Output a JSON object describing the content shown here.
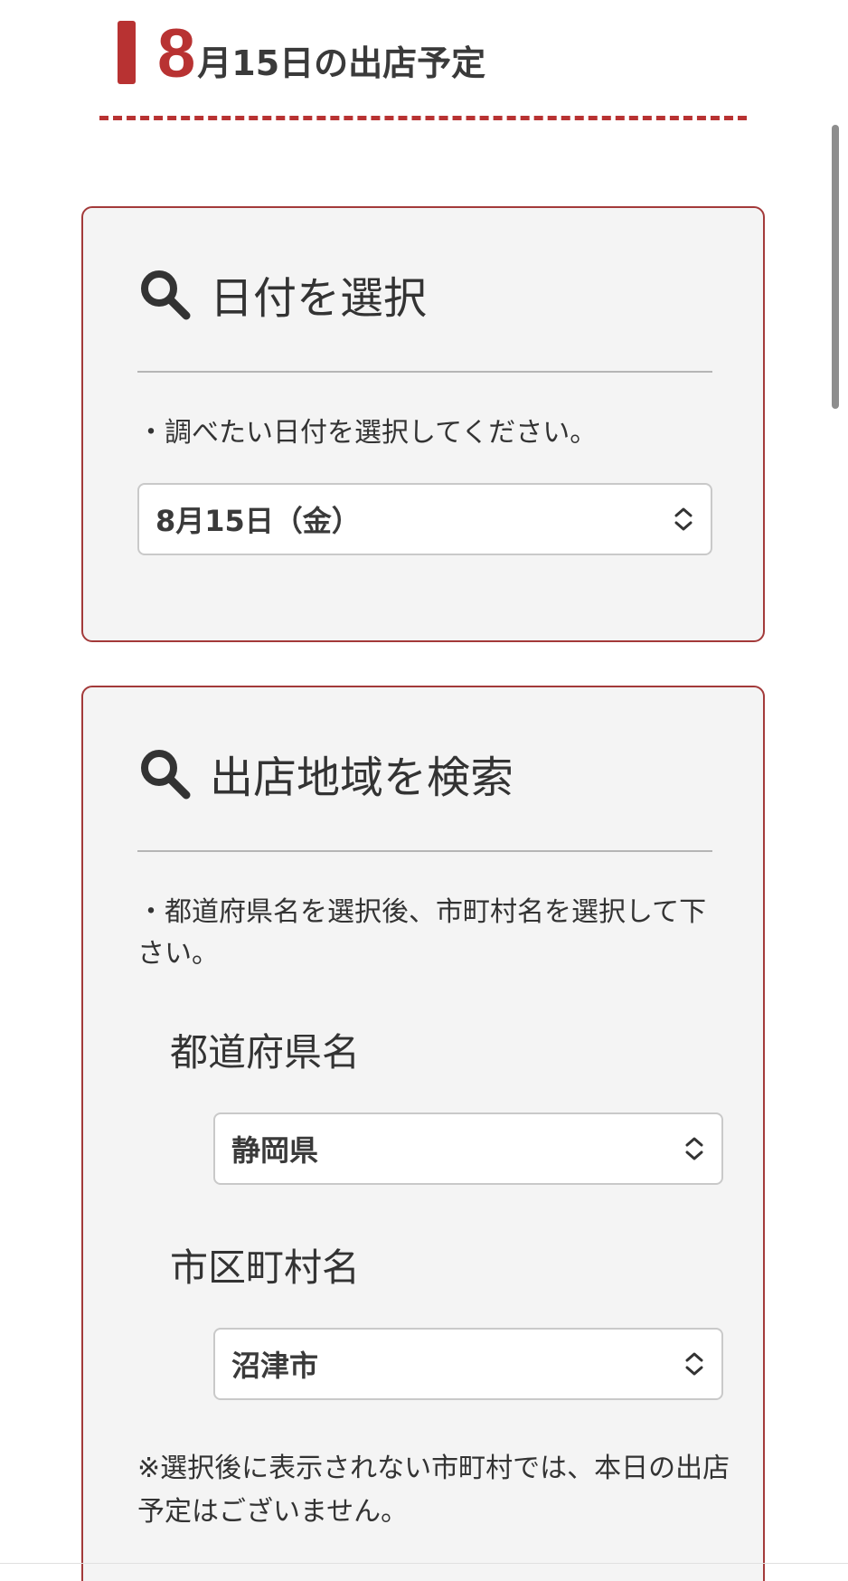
{
  "header": {
    "big_number": "8",
    "title_rest": "月15日の出店予定"
  },
  "date_panel": {
    "title": "日付を選択",
    "instruction": "・調べたい日付を選択してください。",
    "select_value": "8月15日（金）"
  },
  "area_panel": {
    "title": "出店地域を検索",
    "instruction": "・都道府県名を選択後、市町村名を選択して下さい。",
    "prefecture_label": "都道府県名",
    "prefecture_value": "静岡県",
    "city_label": "市区町村名",
    "city_value": "沼津市",
    "note": "※選択後に表示されない市町村では、本日の出店予定はございません。"
  },
  "colors": {
    "accent": "#b83232",
    "panel_bg": "#f4f4f4",
    "panel_border": "#a33a3a"
  },
  "icons": [
    "search-icon",
    "chevron-updown-icon"
  ]
}
